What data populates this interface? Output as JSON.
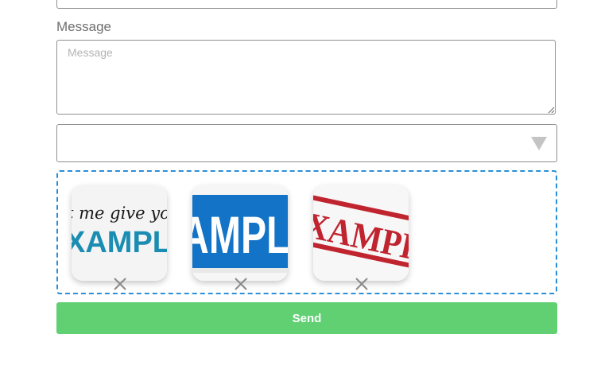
{
  "form": {
    "message_label": "Message",
    "message_placeholder": "Message",
    "message_value": "",
    "select_value": "",
    "send_label": "Send"
  },
  "attachments": [
    {
      "name": "script-sample-image",
      "text_top": "t me give you",
      "text_main": "XAMPL"
    },
    {
      "name": "blue-sample-image",
      "text_main": "AMPLI"
    },
    {
      "name": "red-stamp-sample-image",
      "text_main": "XAMPL"
    }
  ],
  "colors": {
    "accent_border": "#2a8fd8",
    "send_button": "#61d073",
    "field_border": "#8f8f8f",
    "label_text": "#6f6f6f",
    "sample_teal": "#1b8db3",
    "sample_blue": "#1273c7",
    "sample_red": "#c0242e"
  },
  "icons": {
    "remove": "close-icon",
    "select_arrow": "triangle-down-icon",
    "resize": "resize-grip-icon"
  }
}
